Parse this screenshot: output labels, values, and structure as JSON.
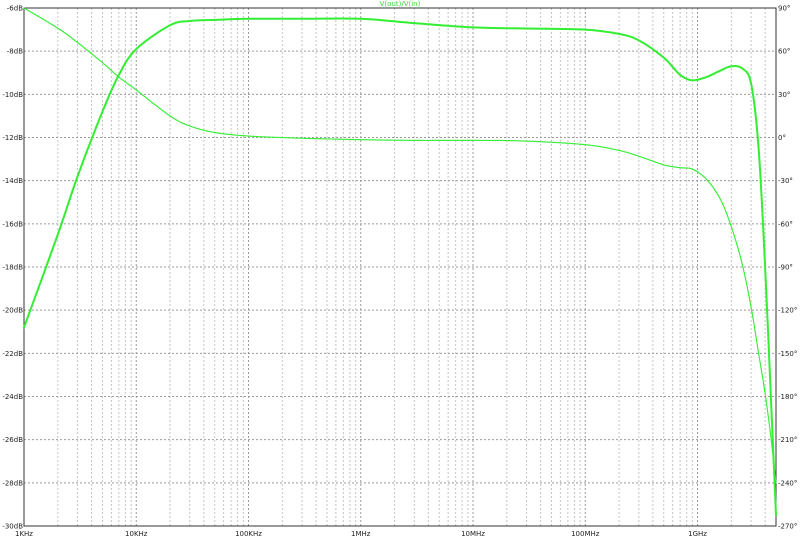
{
  "chart_data": {
    "type": "line",
    "title": "V(out)/V(in)",
    "x_scale": "log",
    "x_unit": "Hz",
    "xlim": [
      1000,
      5000000000
    ],
    "x_ticks": [
      {
        "value": 1000,
        "label": "1KHz"
      },
      {
        "value": 10000,
        "label": "10KHz"
      },
      {
        "value": 100000,
        "label": "100KHz"
      },
      {
        "value": 1000000,
        "label": "1MHz"
      },
      {
        "value": 10000000,
        "label": "10MHz"
      },
      {
        "value": 100000000,
        "label": "100MHz"
      },
      {
        "value": 1000000000,
        "label": "1GHz"
      }
    ],
    "ylim_left": [
      -30,
      -6
    ],
    "y_ticks_left": [
      {
        "value": -6,
        "label": "-6dB"
      },
      {
        "value": -8,
        "label": "-8dB"
      },
      {
        "value": -10,
        "label": "-10dB"
      },
      {
        "value": -12,
        "label": "-12dB"
      },
      {
        "value": -14,
        "label": "-14dB"
      },
      {
        "value": -16,
        "label": "-16dB"
      },
      {
        "value": -18,
        "label": "-18dB"
      },
      {
        "value": -20,
        "label": "-20dB"
      },
      {
        "value": -22,
        "label": "-22dB"
      },
      {
        "value": -24,
        "label": "-24dB"
      },
      {
        "value": -26,
        "label": "-26dB"
      },
      {
        "value": -28,
        "label": "-28dB"
      },
      {
        "value": -30,
        "label": "-30dB"
      }
    ],
    "ylim_right": [
      -270,
      90
    ],
    "y_ticks_right": [
      {
        "value": 90,
        "label": "90°"
      },
      {
        "value": 60,
        "label": "60°"
      },
      {
        "value": 30,
        "label": "30°"
      },
      {
        "value": 0,
        "label": "0°"
      },
      {
        "value": -30,
        "label": "-30°"
      },
      {
        "value": -60,
        "label": "-60°"
      },
      {
        "value": -90,
        "label": "-90°"
      },
      {
        "value": -120,
        "label": "-120°"
      },
      {
        "value": -150,
        "label": "-150°"
      },
      {
        "value": -180,
        "label": "-180°"
      },
      {
        "value": -210,
        "label": "-210°"
      },
      {
        "value": -240,
        "label": "-240°"
      },
      {
        "value": -270,
        "label": "-270°"
      }
    ],
    "grid": true,
    "series": [
      {
        "axis": "left",
        "style": "solid",
        "color": "#33ee33",
        "x": [
          1000,
          2000,
          3000,
          5000,
          7000,
          10000,
          20000,
          30000,
          50000,
          100000,
          300000,
          1000000,
          3000000,
          10000000,
          30000000,
          100000000,
          200000000,
          300000000,
          500000000,
          700000000,
          900000000,
          1200000000,
          1600000000,
          2000000000,
          2500000000,
          3000000000,
          3500000000,
          4000000000,
          4500000000,
          5000000000
        ],
        "values": [
          -20.8,
          -16.5,
          -13.8,
          -10.8,
          -9.1,
          -7.9,
          -6.8,
          -6.6,
          -6.55,
          -6.5,
          -6.5,
          -6.5,
          -6.7,
          -6.9,
          -6.95,
          -7.0,
          -7.2,
          -7.5,
          -8.3,
          -9.1,
          -9.35,
          -9.2,
          -8.9,
          -8.7,
          -8.8,
          -9.5,
          -12.5,
          -18.0,
          -24.0,
          -29.5
        ]
      },
      {
        "axis": "right",
        "style": "dotted",
        "color": "#33ee33",
        "x": [
          1000,
          2000,
          3000,
          5000,
          7000,
          10000,
          20000,
          30000,
          50000,
          100000,
          300000,
          1000000,
          3000000,
          10000000,
          30000000,
          100000000,
          200000000,
          300000000,
          500000000,
          700000000,
          900000000,
          1200000000,
          1600000000,
          2000000000,
          2500000000,
          3000000000,
          3500000000,
          4000000000,
          4500000000,
          5000000000
        ],
        "values": [
          90,
          76,
          66,
          52,
          42,
          33,
          15,
          8,
          3.5,
          1,
          -0.5,
          -1.5,
          -2,
          -2,
          -2.5,
          -5,
          -9,
          -13,
          -19,
          -21,
          -22,
          -29,
          -43,
          -62,
          -88,
          -118,
          -150,
          -178,
          -208,
          -240
        ]
      }
    ]
  }
}
